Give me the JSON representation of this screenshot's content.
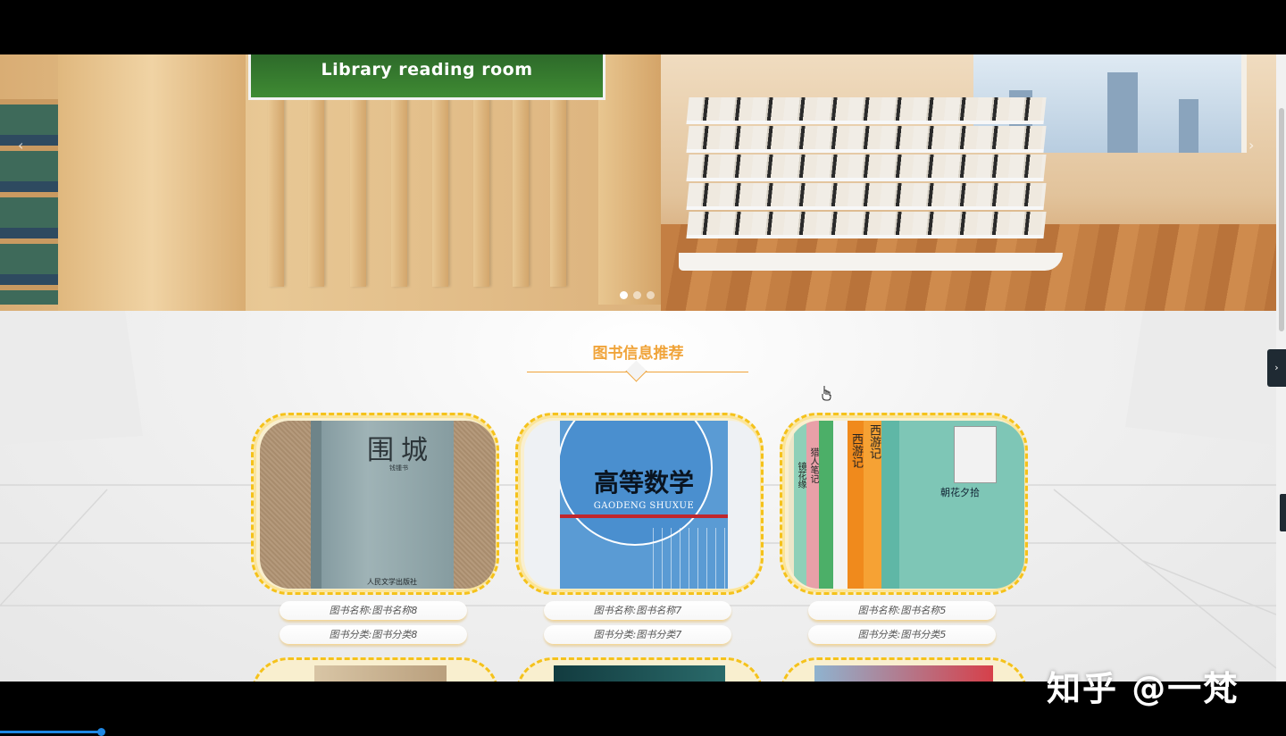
{
  "banner": {
    "sign_text": "Library reading room",
    "prev_arrow": "‹",
    "next_arrow": "›",
    "slide_count": 3,
    "active_slide": 1
  },
  "section": {
    "title": "图书信息推荐",
    "title_color": "#f0a43a"
  },
  "books": [
    {
      "name": "图书名称:图书名称8",
      "category": "图书分类:图书分类8",
      "cover": {
        "title": "围城",
        "author": "钱锺书",
        "publisher": "人民文学出版社"
      }
    },
    {
      "name": "图书名称:图书名称7",
      "category": "图书分类:图书分类7",
      "cover": {
        "title": "高等数学",
        "subtitle": "GAODENG SHUXUE"
      }
    },
    {
      "name": "图书名称:图书名称5",
      "category": "图书分类:图书分类5",
      "cover": {
        "title": "朝花夕拾",
        "spines": [
          "镜花缘",
          "猎人笔记",
          "西游记",
          "西游记"
        ]
      }
    }
  ],
  "side_tab_icon": "chevron-right-icon",
  "side_tab_glyph": "›",
  "watermark": "知乎 @一梵",
  "video_progress": 0.08
}
